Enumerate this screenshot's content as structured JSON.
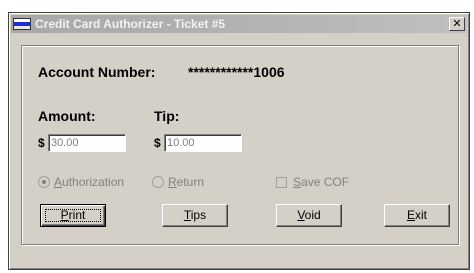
{
  "window": {
    "title": "Credit Card Authorizer - Ticket #5",
    "close_glyph": "✕"
  },
  "account": {
    "label": "Account Number:",
    "value": "************1006"
  },
  "amount": {
    "label": "Amount:",
    "currency": "$",
    "value": "30.00"
  },
  "tip": {
    "label": "Tip:",
    "currency": "$",
    "value": "10.00"
  },
  "options": {
    "authorization": {
      "label_u": "A",
      "label_rest": "uthorization",
      "checked": true
    },
    "return": {
      "label_u": "R",
      "label_rest": "eturn",
      "checked": false
    },
    "save_cof": {
      "label_u": "S",
      "label_rest": "ave COF",
      "checked": false
    }
  },
  "buttons": {
    "print": {
      "u": "P",
      "rest": "rint"
    },
    "tips": {
      "u": "T",
      "rest": "ips"
    },
    "void": {
      "u": "V",
      "rest": "oid"
    },
    "exit": {
      "u": "E",
      "rest": "xit"
    }
  }
}
